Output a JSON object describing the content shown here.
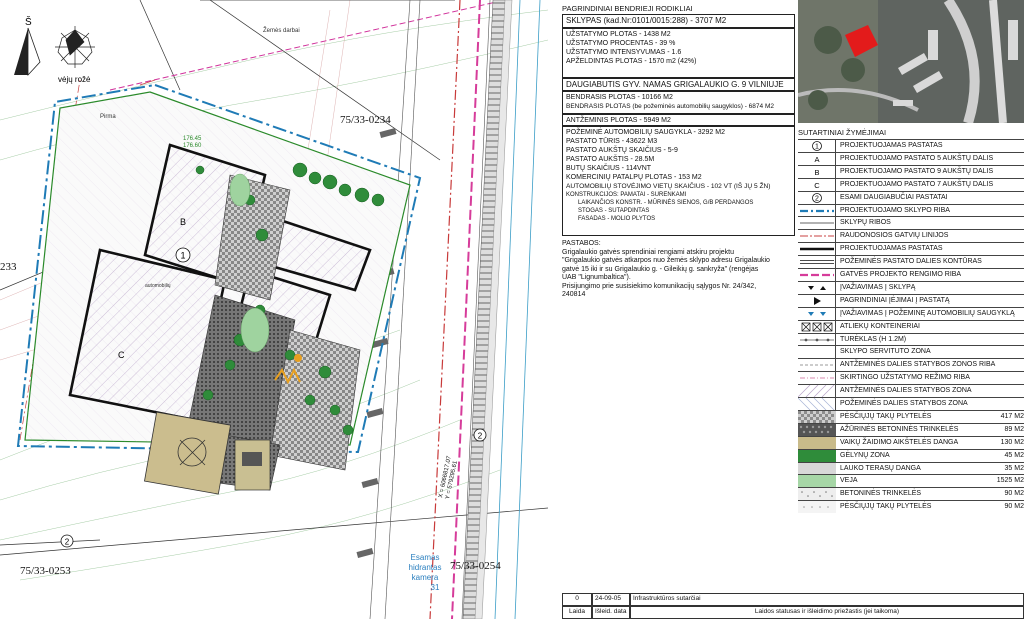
{
  "plan": {
    "north_letter": "Š",
    "wind_rose_label": "vėjų rožė",
    "plot_ids": [
      "75/33-0234",
      "75/33-0253",
      "75/33-0254",
      "233"
    ],
    "land_works_label": "Žemės darbai",
    "building_markers": [
      "1",
      "B",
      "C",
      "2"
    ],
    "hydrant_lines": [
      "Esamas",
      "hidrantas",
      "kamera",
      "31"
    ],
    "coord_x": "X = 6066817.07",
    "coord_y": "Y = 579295.61",
    "elevation": "176.45",
    "elevation_2": "176.60",
    "label_stairs": "automobilių",
    "label_parking": "Pirma"
  },
  "indicators": {
    "title": "PAGRINDINIAI BENDRIEJI RODIKLIAI",
    "plot": "SKLYPAS (kad.Nr:0101/0015:288) - 3707 M2",
    "plot_lines": [
      "UŽSTATYMO PLOTAS  -  1438  M2",
      "UŽSTATYMO PROCENTAS  -  39 %",
      "UŽSTATYMO INTENSYVUMAS  -  1.6",
      "APŽELDINTAS PLOTAS  -  1570 m2  (42%)"
    ],
    "building": "DAUGIABUTIS GYV. NAMAS GRIGALAUKIO G. 9  VILNIUJE",
    "area_lines": [
      "BENDRASIS  PLOTAS  - 10166 M2",
      "BENDRASIS  PLOTAS (be požeminės automobilių saugyklos) - 6874  M2"
    ],
    "above": "ANTŽEMINIS PLOTAS - 5949 M2",
    "under_lines": [
      "POŽEMINĖ AUTOMOBILIŲ SAUGYKLA - 3292 M2",
      "PASTATO TŪRIS - 43622 M3",
      "PASTATO AUKŠTŲ SKAIČIUS - 5-9",
      "PASTATO AUKŠTIS - 28.5M",
      "BUTŲ SKAIČIUS - 114VNT",
      "KOMERCINIŲ PATALPŲ PLOTAS - 153 M2",
      "AUTOMOBILIŲ STOVĖJIMO VIETŲ SKAIČIUS - 102 VT (IŠ JŲ 5 ŽN)"
    ],
    "construction_lines": [
      "KONSTRUKCIJOS: PAMATAI - SURENKAMI",
      "LAIKANČIOS KONSTR. - MŪRINĖS SIENOS, G/B PERDANGOS",
      "STOGAS - SUTAPDINTAS",
      "FASADAS - MOLIO PLYTOS"
    ]
  },
  "notes": {
    "title": "PASTABOS:",
    "lines": [
      "Grigalaukio gatvės sprendiniai rengiami atskiru projektu",
      "\"Grigalaukio gatvės atkarpos nuo žemės sklypo adresu Grigalaukio",
      "gatvė 15 iki ir su Grigalaukio g. - Gileikių g. sankryža\" (rengėjas",
      "UAB \"Lignumbaltica\").",
      "Prisijungimo prie susisiekimo komunikacijų sąlygos Nr. 24/342,",
      "240814"
    ]
  },
  "legend": {
    "title": "SUTARTINIAI ŽYMĖJIMAI",
    "items": [
      {
        "sym": "1",
        "kind": "circle",
        "label": "PROJEKTUOJAMAS PASTATAS",
        "value": ""
      },
      {
        "sym": "A",
        "kind": "letter",
        "label": "PROJEKTUOJAMO PASTATO 5 AUKŠTŲ DALIS",
        "value": ""
      },
      {
        "sym": "B",
        "kind": "letter",
        "label": "PROJEKTUOJAMO PASTATO 9 AUKŠTŲ DALIS",
        "value": ""
      },
      {
        "sym": "C",
        "kind": "letter",
        "label": "PROJEKTUOJAMO PASTATO 7 AUKŠTŲ DALIS",
        "value": ""
      },
      {
        "sym": "2",
        "kind": "circle",
        "label": "ESAMI DAUGIABUČIAI PASTATAI",
        "value": ""
      },
      {
        "sym": "",
        "kind": "line-blue",
        "label": "PROJEKTUOJAMO SKLYPO RIBA",
        "value": ""
      },
      {
        "sym": "",
        "kind": "line-thin",
        "label": "SKLYPŲ RIBOS",
        "value": ""
      },
      {
        "sym": "",
        "kind": "line-red",
        "label": "RAUDONOSIOS GATVIŲ LINIJOS",
        "value": ""
      },
      {
        "sym": "",
        "kind": "line-bold",
        "label": "PROJEKTUOJAMAS PASTATAS",
        "value": ""
      },
      {
        "sym": "",
        "kind": "line-double",
        "label": "POŽEMINĖS PASTATO DALIES KONTŪRAS",
        "value": ""
      },
      {
        "sym": "",
        "kind": "line-magenta",
        "label": "GATVĖS PROJEKTO RENGIMO RIBA",
        "value": ""
      },
      {
        "sym": "",
        "kind": "arrows-black",
        "label": "ĮVAŽIAVIMAS Į SKLYPĄ",
        "value": ""
      },
      {
        "sym": "",
        "kind": "triangle",
        "label": "PAGRINDINIAI ĮĖJIMAI Į PASTATĄ",
        "value": ""
      },
      {
        "sym": "",
        "kind": "arrows-blue",
        "label": "ĮVAŽIAVIMAS Į POŽEMINĘ AUTOMOBILIŲ SAUGYKLĄ",
        "value": ""
      },
      {
        "sym": "",
        "kind": "boxes",
        "label": "ATLIEKŲ KONTEINERIAI",
        "value": ""
      },
      {
        "sym": "",
        "kind": "fence",
        "label": "TURĖKLAS  (H 1.2M)",
        "value": ""
      },
      {
        "sym": "",
        "kind": "blank",
        "label": "SKLYPO SERVITUTO ZONA",
        "value": ""
      },
      {
        "sym": "",
        "kind": "dash-gray",
        "label": "ANTŽEMINĖS DALIES STATYBOS ZONOS RIBA",
        "value": ""
      },
      {
        "sym": "",
        "kind": "dash-pink",
        "label": "SKIRTINGO UŽSTATYMO REŽIMO RIBA",
        "value": ""
      },
      {
        "sym": "",
        "kind": "hatch-pink",
        "label": "ANTŽEMINĖS DALIES STATYBOS ZONA",
        "value": ""
      },
      {
        "sym": "",
        "kind": "hatch-blue",
        "label": "POŽEMINĖS DALIES STATYBOS ZONA",
        "value": ""
      },
      {
        "sym": "",
        "kind": "fill-checker-light",
        "label": "PĖSČIŲJŲ TAKŲ PLYTELĖS",
        "value": "417 M2"
      },
      {
        "sym": "",
        "kind": "fill-checker-dark",
        "label": "AŽŪRINĖS BETONINĖS TRINKELĖS",
        "value": "89 M2"
      },
      {
        "sym": "",
        "kind": "fill-tan",
        "label": "VAIKŲ ŽAIDIMO AIKŠTELĖS DANGA",
        "value": "130 M2"
      },
      {
        "sym": "",
        "kind": "fill-green",
        "label": "GĖLYNŲ ZONA",
        "value": "45 M2"
      },
      {
        "sym": "",
        "kind": "fill-lightgray",
        "label": "LAUKO TERASŲ DANGA",
        "value": "35 M2"
      },
      {
        "sym": "",
        "kind": "fill-paleGreen",
        "label": "VEJA",
        "value": "1525 M2"
      },
      {
        "sym": "",
        "kind": "fill-dots",
        "label": "BETONINĖS TRINKELĖS",
        "value": "90 M2"
      },
      {
        "sym": "",
        "kind": "fill-dots2",
        "label": "PĖSČIŲJŲ TAKŲ PLYTELĖS",
        "value": "90 M2"
      }
    ]
  },
  "revision": {
    "num": "0",
    "date": "24-09-05",
    "desc": "Infrastruktūros sutarčiai",
    "h_issue": "Laida",
    "h_date": "Išleid. data",
    "h_reason": "Laidos statusas ir išleidimo priežastis (jei taikoma)"
  }
}
